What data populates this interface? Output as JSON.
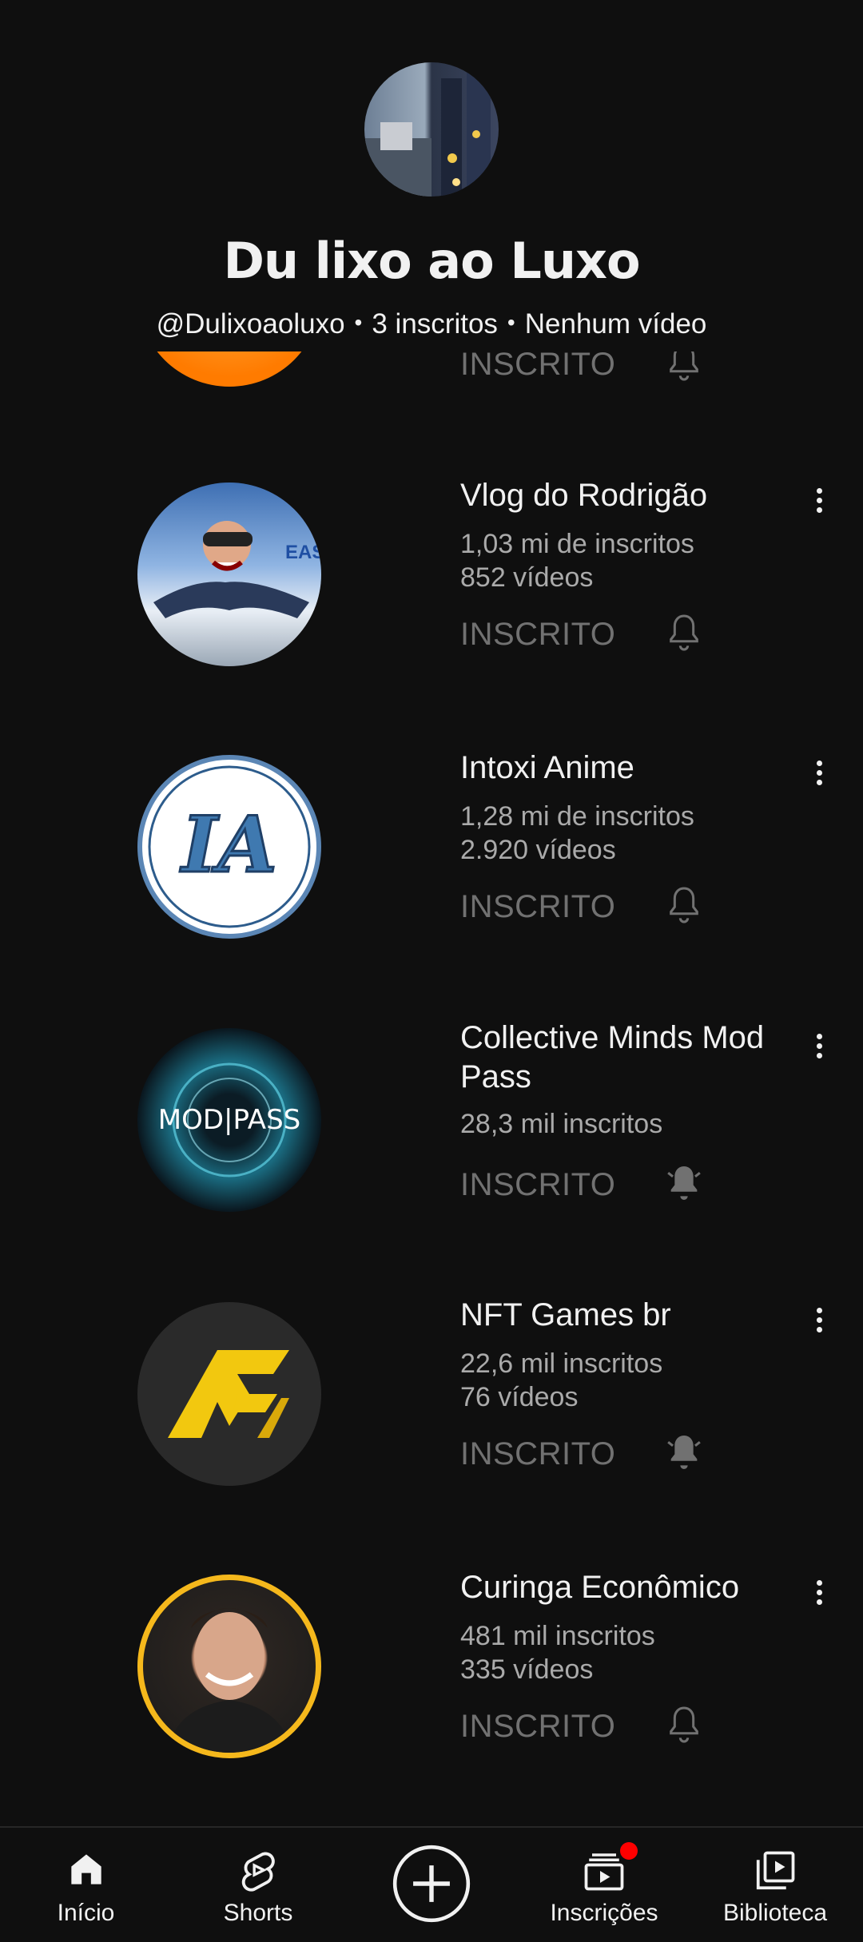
{
  "header": {
    "title": "Du lixo ao Luxo",
    "handle": "@Dulixoaoluxo",
    "subscribers": "3 inscritos",
    "videos": "Nenhum vídeo",
    "separator": "•"
  },
  "subscriptions": [
    {
      "name": "",
      "subscribers": "",
      "videos": "",
      "status": "INSCRITO",
      "bell": "outline"
    },
    {
      "name": "Vlog do Rodrigão",
      "subscribers": "1,03 mi de inscritos",
      "videos": "852 vídeos",
      "status": "INSCRITO",
      "bell": "outline"
    },
    {
      "name": "Intoxi Anime",
      "subscribers": "1,28 mi de inscritos",
      "videos": "2.920 vídeos",
      "status": "INSCRITO",
      "bell": "outline"
    },
    {
      "name": "Collective Minds Mod Pass",
      "subscribers": "28,3 mil inscritos",
      "videos": "",
      "status": "INSCRITO",
      "bell": "filled"
    },
    {
      "name": "NFT Games br",
      "subscribers": "22,6 mil inscritos",
      "videos": "76 vídeos",
      "status": "INSCRITO",
      "bell": "filled"
    },
    {
      "name": "Curinga Econômico",
      "subscribers": "481 mil inscritos",
      "videos": "335 vídeos",
      "status": "INSCRITO",
      "bell": "outline"
    }
  ],
  "avatar_text": {
    "modpass": "MOD|PASS",
    "intoxi": "IA",
    "rodrigao": "EAS"
  },
  "nav": {
    "home": "Início",
    "shorts": "Shorts",
    "subscriptions": "Inscrições",
    "library": "Biblioteca"
  },
  "colors": {
    "background": "#0f0f0f",
    "text": "#f1f1f1",
    "secondary": "#aaaaaa",
    "subscribed": "#717171",
    "badge": "#ff0000",
    "curinga_ring": "#f5b81c"
  }
}
